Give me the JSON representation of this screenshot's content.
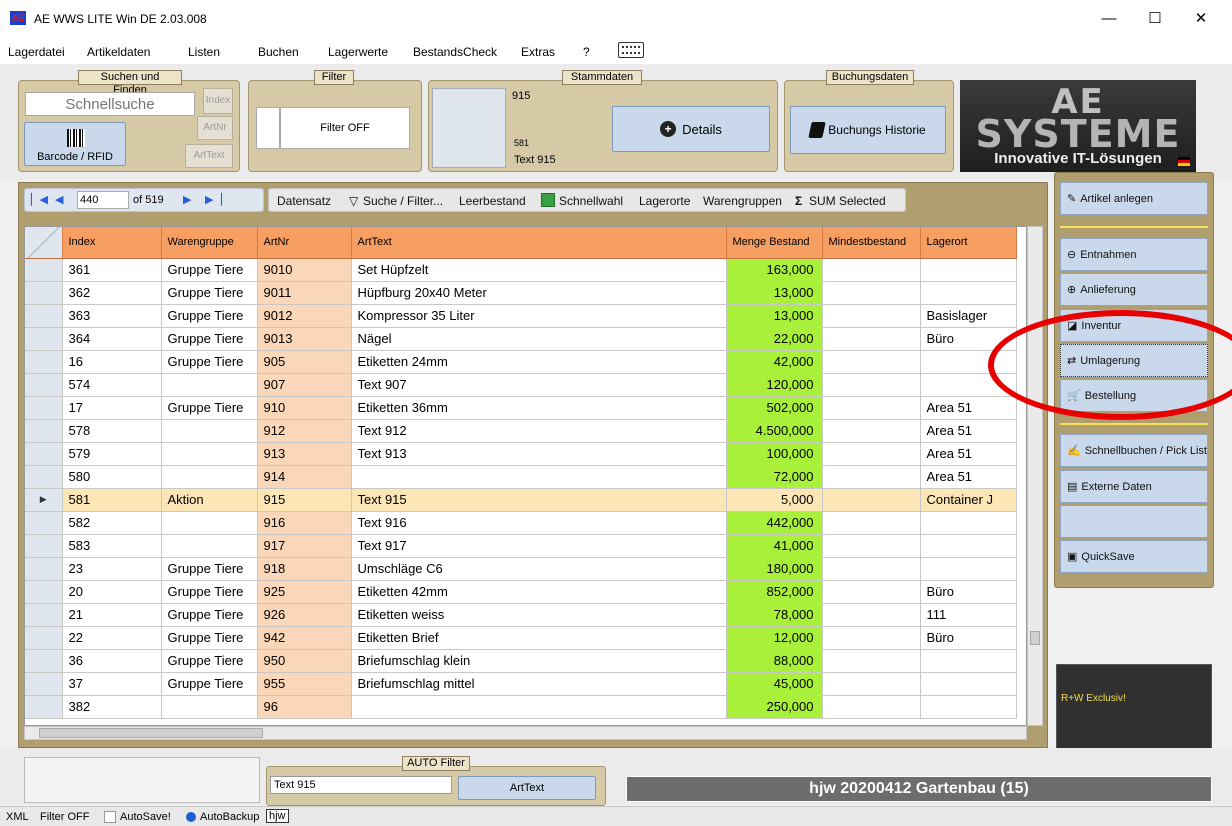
{
  "window": {
    "title": "AE WWS LITE Win DE 2.03.008",
    "app_icon": "AE",
    "minimize": "—",
    "maximize": "☐",
    "close": "✕"
  },
  "menu": [
    "Lagerdatei",
    "Artikeldaten",
    "Listen",
    "Buchen",
    "Lagerwerte",
    "BestandsCheck",
    "Extras",
    "?"
  ],
  "search_group": {
    "title": "Suchen und Finden",
    "placeholder": "Schnellsuche",
    "index_btn": "Index",
    "artnr_btn": "ArtNr",
    "arttext_btn": "ArtText",
    "barcode_btn": "Barcode / RFID"
  },
  "filter_group": {
    "title": "Filter",
    "status": "Filter OFF"
  },
  "stamm_group": {
    "title": "Stammdaten",
    "artnr": "915",
    "index": "581",
    "text": "Text 915",
    "details_btn": "Details"
  },
  "buchung_group": {
    "title": "Buchungsdaten",
    "history_btn": "Buchungs Historie"
  },
  "logo": {
    "ae": "AE",
    "systeme": "SYSTEME",
    "tagline": "Innovative IT-Lösungen"
  },
  "nav": {
    "record": "440",
    "of": "of 519"
  },
  "toolbar": [
    "Datensatz",
    "Suche / Filter...",
    "Leerbestand",
    "Schnellwahl",
    "Lagerorte",
    "Warengruppen",
    "SUM Selected"
  ],
  "columns": [
    "Index",
    "Warengruppe",
    "ArtNr",
    "ArtText",
    "Menge Bestand",
    "Mindestbestand",
    "Lagerort"
  ],
  "rows": [
    [
      "361",
      "Gruppe Tiere",
      "9010",
      "Set Hüpfzelt",
      "163,000",
      "",
      ""
    ],
    [
      "362",
      "Gruppe Tiere",
      "9011",
      "Hüpfburg 20x40 Meter",
      "13,000",
      "",
      ""
    ],
    [
      "363",
      "Gruppe Tiere",
      "9012",
      "Kompressor 35 Liter",
      "13,000",
      "",
      "Basislager"
    ],
    [
      "364",
      "Gruppe Tiere",
      "9013",
      "Nägel",
      "22,000",
      "",
      "Büro"
    ],
    [
      "16",
      "Gruppe Tiere",
      "905",
      "Etiketten 24mm",
      "42,000",
      "",
      ""
    ],
    [
      "574",
      "",
      "907",
      "Text 907",
      "120,000",
      "",
      ""
    ],
    [
      "17",
      "Gruppe Tiere",
      "910",
      "Etiketten 36mm",
      "502,000",
      "",
      "Area 51"
    ],
    [
      "578",
      "",
      "912",
      "Text 912",
      "4.500,000",
      "",
      "Area 51"
    ],
    [
      "579",
      "",
      "913",
      "Text 913",
      "100,000",
      "",
      "Area 51"
    ],
    [
      "580",
      "",
      "914",
      "",
      "72,000",
      "",
      "Area 51"
    ],
    [
      "581",
      "Aktion",
      "915",
      "Text 915",
      "5,000",
      "",
      "Container J"
    ],
    [
      "582",
      "",
      "916",
      "Text 916",
      "442,000",
      "",
      ""
    ],
    [
      "583",
      "",
      "917",
      "Text 917",
      "41,000",
      "",
      ""
    ],
    [
      "23",
      "Gruppe Tiere",
      "918",
      "Umschläge C6",
      "180,000",
      "",
      ""
    ],
    [
      "20",
      "Gruppe Tiere",
      "925",
      "Etiketten 42mm",
      "852,000",
      "",
      "Büro"
    ],
    [
      "21",
      "Gruppe Tiere",
      "926",
      "Etiketten weiss",
      "78,000",
      "",
      "111"
    ],
    [
      "22",
      "Gruppe Tiere",
      "942",
      "Etiketten Brief",
      "12,000",
      "",
      "Büro"
    ],
    [
      "36",
      "Gruppe Tiere",
      "950",
      "Briefumschlag klein",
      "88,000",
      "",
      ""
    ],
    [
      "37",
      "Gruppe Tiere",
      "955",
      "Briefumschlag mittel",
      "45,000",
      "",
      ""
    ],
    [
      "382",
      "",
      "96",
      "",
      "250,000",
      "",
      ""
    ]
  ],
  "current_row": 10,
  "right_buttons": {
    "artikel_anlegen": "Artikel anlegen",
    "entnahmen": "Entnahmen",
    "anlieferung": "Anlieferung",
    "inventur": "Inventur",
    "umlagerung": "Umlagerung",
    "bestellung": "Bestellung",
    "schnellbuchen": "Schnellbuchen / Pick List",
    "externe": "Externe Daten",
    "quicksave": "QuickSave"
  },
  "exclusive": "R+W Exclusiv!",
  "auto_filter": {
    "title": "AUTO Filter",
    "value": "Text 915",
    "button": "ArtText"
  },
  "status_box": "hjw 20200412 Gartenbau (15)",
  "statusbar": {
    "xml": "XML",
    "filter": "Filter OFF",
    "autosave": "AutoSave!",
    "autobackup": "AutoBackup",
    "user": "hjw"
  },
  "colors": {
    "header": "#f79f63",
    "artnr": "#fad7b8",
    "menge": "#a8f03a",
    "current": "#fde6b6",
    "panel": "#b09e6e",
    "button": "#c9d8ea",
    "annotation": "#e80000"
  }
}
